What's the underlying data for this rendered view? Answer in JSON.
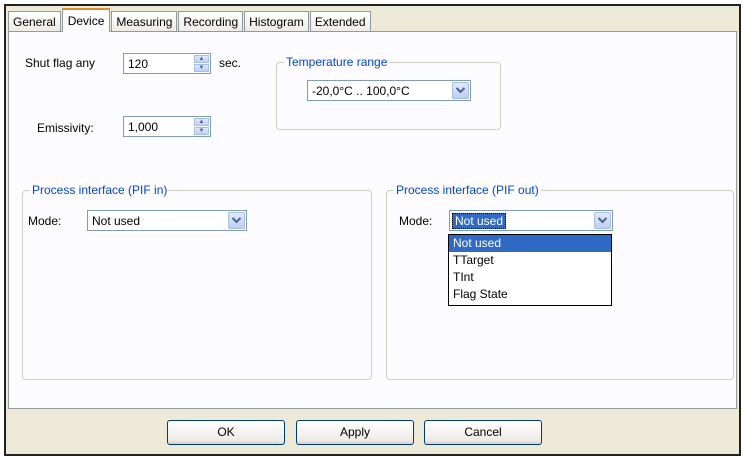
{
  "tabs": [
    "General",
    "Device",
    "Measuring",
    "Recording",
    "Histogram",
    "Extended"
  ],
  "active_tab": "Device",
  "shut_flag": {
    "label": "Shut flag any",
    "value": "120",
    "unit": "sec."
  },
  "emissivity": {
    "label": "Emissivity:",
    "value": "1,000"
  },
  "temperature_range": {
    "title": "Temperature range",
    "value": "-20,0°C .. 100,0°C"
  },
  "pif_in": {
    "title": "Process interface (PIF in)",
    "mode_label": "Mode:",
    "mode_value": "Not used"
  },
  "pif_out": {
    "title": "Process interface (PIF out)",
    "mode_label": "Mode:",
    "mode_value": "Not used",
    "options": [
      "Not used",
      "TTarget",
      "TInt",
      "Flag State"
    ]
  },
  "buttons": {
    "ok": "OK",
    "apply": "Apply",
    "cancel": "Cancel"
  },
  "colors": {
    "accent": "#316ac5",
    "group_title": "#0046d5",
    "tab_highlight": "#e68b2c"
  }
}
